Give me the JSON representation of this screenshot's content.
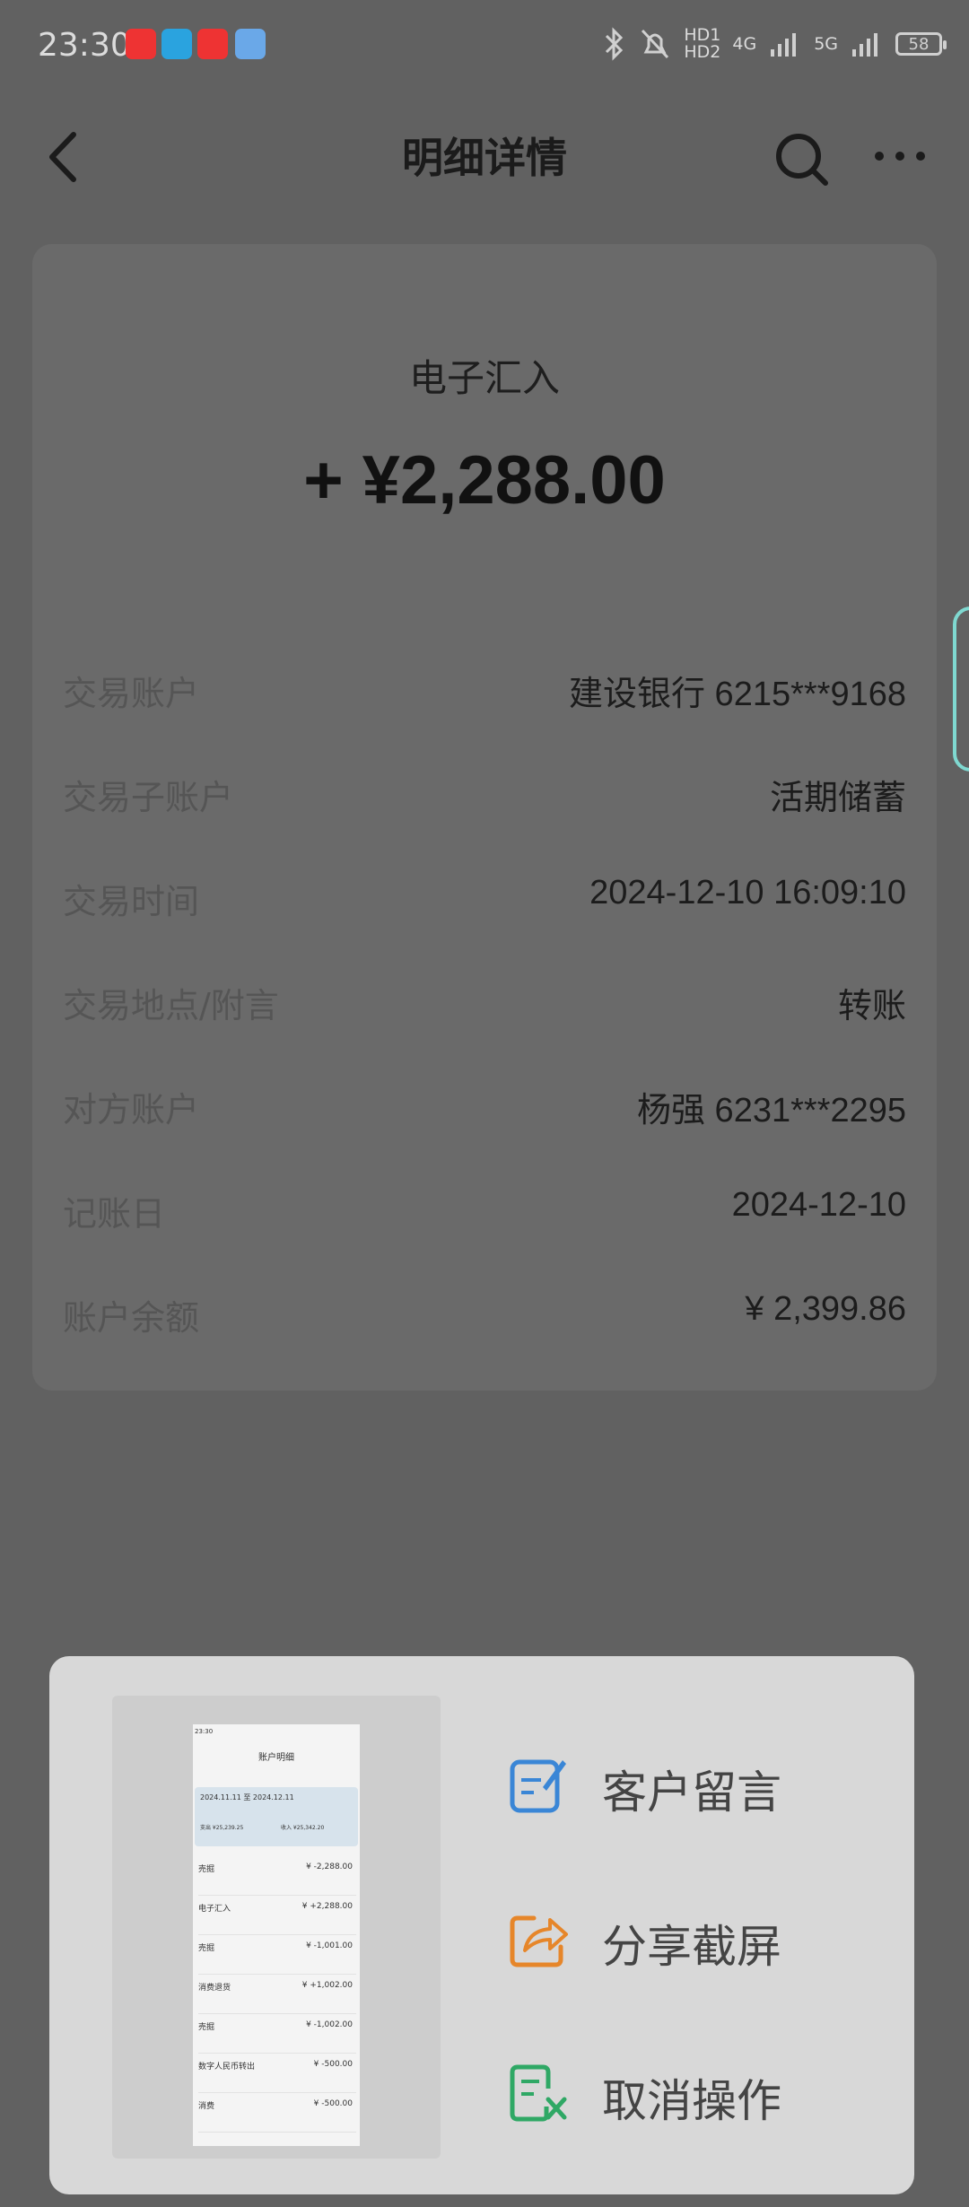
{
  "status_bar": {
    "time": "23:30",
    "network_hd": "HD1 HD2",
    "network_4g": "4G",
    "network_5g": "5G",
    "battery": "58",
    "icons": [
      "netease-music-icon",
      "telegram-icon",
      "kuaishou-icon",
      "mail-icon",
      "bluetooth-icon",
      "mute-bell-icon",
      "signal-icon"
    ]
  },
  "nav": {
    "title": "明细详情"
  },
  "detail": {
    "type": "电子汇入",
    "amount": "+ ¥2,288.00",
    "rows": [
      {
        "label": "交易账户",
        "value": "建设银行 6215***9168"
      },
      {
        "label": "交易子账户",
        "value": "活期储蓄"
      },
      {
        "label": "交易时间",
        "value": "2024-12-10 16:09:10"
      },
      {
        "label": "交易地点/附言",
        "value": "转账"
      },
      {
        "label": "对方账户",
        "value": "杨强 6231***2295"
      },
      {
        "label": "记账日",
        "value": "2024-12-10"
      },
      {
        "label": "账户余额",
        "value": "¥ 2,399.86"
      }
    ]
  },
  "popup": {
    "thumbnail": {
      "time": "23:30",
      "title": "账户明细",
      "date_range": "2024.11.11 至 2024.12.11",
      "out_label": "支出 ¥25,239.25",
      "in_label": "收入 ¥25,342.20",
      "items": [
        {
          "name": "売掘",
          "amount": "¥ -2,288.00"
        },
        {
          "name": "电子汇入",
          "amount": "¥ +2,288.00"
        },
        {
          "name": "売掘",
          "amount": "¥ -1,001.00"
        },
        {
          "name": "消费退货",
          "amount": "¥ +1,002.00"
        },
        {
          "name": "売掘",
          "amount": "¥ -1,002.00"
        },
        {
          "name": "数字人民币转出",
          "amount": "¥ -500.00"
        },
        {
          "name": "消费",
          "amount": "¥ -500.00"
        }
      ]
    },
    "actions": [
      {
        "label": "客户留言",
        "icon": "message-edit-icon",
        "color": "#3a86d6"
      },
      {
        "label": "分享截屏",
        "icon": "share-icon",
        "color": "#e6862a"
      },
      {
        "label": "取消操作",
        "icon": "cancel-doc-icon",
        "color": "#2fa865"
      }
    ]
  }
}
